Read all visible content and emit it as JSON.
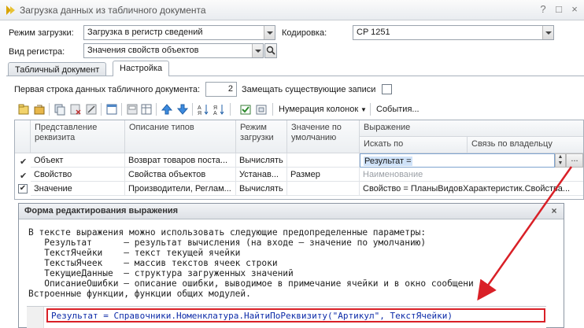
{
  "window": {
    "title": "Загрузка данных из табличного документа",
    "help_glyph": "?",
    "maximize_glyph": "□",
    "close_glyph": "×"
  },
  "form": {
    "mode_label": "Режим загрузки:",
    "mode_value": "Загрузка в регистр сведений",
    "encoding_label": "Кодировка:",
    "encoding_value": "CP 1251",
    "register_label": "Вид регистра:",
    "register_value": "Значения свойств объектов"
  },
  "tabs": [
    {
      "label": "Табличный документ",
      "active": false
    },
    {
      "label": "Настройка",
      "active": true
    }
  ],
  "settings": {
    "first_row_label": "Первая строка данных табличного документа:",
    "first_row_value": "2",
    "replace_label": "Замещать существующие записи"
  },
  "toolbar": {
    "numbering_label": "Нумерация колонок",
    "events_label": "События..."
  },
  "grid": {
    "headers": {
      "presentation": "Представление реквизита",
      "types": "Описание типов",
      "mode": "Режим загрузки",
      "default": "Значение по умолчанию",
      "expression": "Выражение",
      "search_by": "Искать по",
      "owner_link": "Связь по владельцу"
    },
    "rows": [
      {
        "check": "✔",
        "name": "Объект",
        "types": "Возврат товаров поста...",
        "mode": "Вычислять",
        "default": "",
        "expression": "Результат =",
        "selected": true
      },
      {
        "check": "✔",
        "name": "Свойство",
        "types": "Свойства объектов",
        "mode": "Устанав...",
        "default": "Размер",
        "expression": "Наименование",
        "selected": false
      },
      {
        "check": "✔",
        "name": "Значение",
        "types": "Производители, Реглам...",
        "mode": "Вычислять",
        "default": "",
        "expression": "Свойство = ПланыВидовХарактеристик.Свойства...",
        "selected": false
      }
    ],
    "ellipsis_glyph": "..."
  },
  "dialog": {
    "title": "Форма редактирования выражения",
    "close_glyph": "×",
    "lines": [
      "В тексте выражения можно использовать следующие предопределенные параметры:",
      "   Результат      – результат вычисления (на входе – значение по умолчанию)",
      "   ТекстЯчейки    – текст текущей ячейки",
      "   ТекстыЯчеек    – массив текстов ячеек строки",
      "   ТекущиеДанные  – структура загруженных значений",
      "   ОписаниеОшибки – описание ошибки, выводимое в примечание ячейки и в окно сообщени",
      "Встроенные функции, функции общих модулей."
    ],
    "code": "Результат = Справочники.Номенклатура.НайтиПоРеквизиту(\"Артикул\", ТекстЯчейки)"
  },
  "colors": {
    "highlight_red": "#d92027",
    "selection_blue": "#cfe2f8"
  }
}
